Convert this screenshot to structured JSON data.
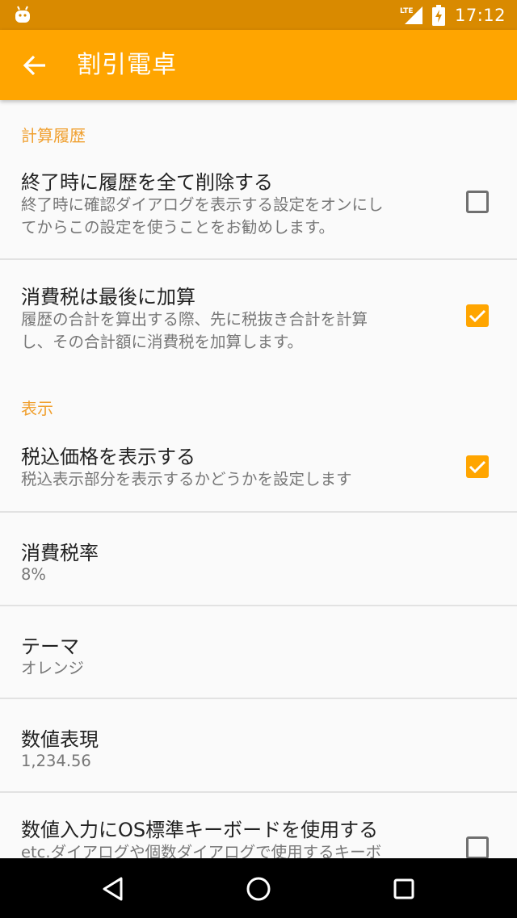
{
  "status_bar": {
    "network": "LTE",
    "time": "17:12",
    "icons": [
      "android-bot-icon",
      "lte-signal-icon",
      "battery-charging-icon"
    ]
  },
  "app_bar": {
    "title": "割引電卓",
    "back_icon": "arrow-back-icon"
  },
  "colors": {
    "accent": "#ffa500",
    "status_bar": "#d98a00",
    "section_header": "#f0a030"
  },
  "sections": {
    "history": {
      "header": "計算履歴",
      "clear_on_exit": {
        "title": "終了時に履歴を全て削除する",
        "summary_line1": "終了時に確認ダイアログを表示する設定をオンにし",
        "summary_line2": "てからこの設定を使うことをお勧めします。",
        "checked": false
      },
      "tax_last": {
        "title": "消費税は最後に加算",
        "summary_line1": "履歴の合計を算出する際、先に税抜き合計を計算",
        "summary_line2": "し、その合計額に消費税を加算します。",
        "checked": true
      }
    },
    "display": {
      "header": "表示",
      "show_tax_price": {
        "title": "税込価格を表示する",
        "summary": "税込表示部分を表示するかどうかを設定します",
        "checked": true
      },
      "tax_rate": {
        "title": "消費税率",
        "value": "8%"
      },
      "theme": {
        "title": "テーマ",
        "value": "オレンジ"
      },
      "number_format": {
        "title": "数値表現",
        "value": "1,234.56"
      },
      "os_keyboard": {
        "title": "数値入力にOS標準キーボードを使用する",
        "summary": "etc.ダイアログや個数ダイアログで使用するキーボ",
        "checked": false
      }
    }
  },
  "nav_bar": {
    "icons": [
      "back-triangle-icon",
      "home-circle-icon",
      "recents-square-icon"
    ]
  }
}
